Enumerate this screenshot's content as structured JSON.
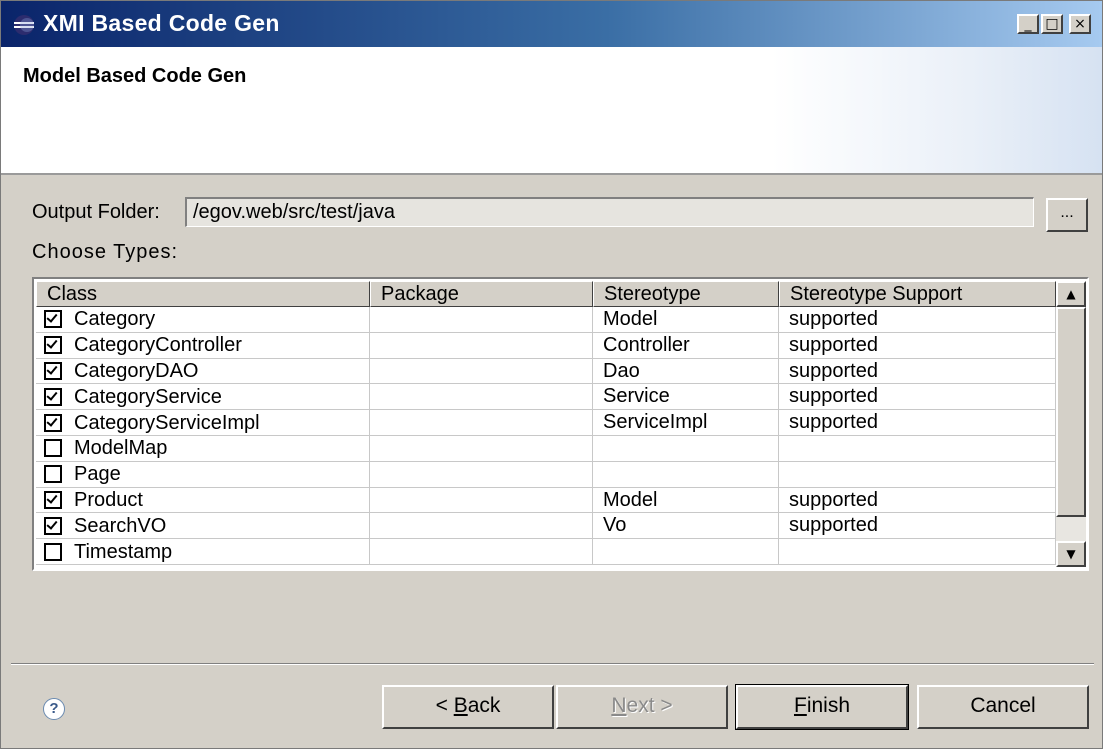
{
  "window": {
    "title": "XMI Based Code Gen",
    "controls": {
      "minimize": "_",
      "maximize": "□",
      "close": "×"
    }
  },
  "header": {
    "title": "Model Based Code Gen"
  },
  "output_folder": {
    "label": "Output Folder:",
    "value": "/egov.web/src/test/java",
    "browse_label": "..."
  },
  "choose_types": {
    "label": "Choose Types:",
    "columns": [
      "Class",
      "Package",
      "Stereotype",
      "Stereotype Support"
    ],
    "rows": [
      {
        "checked": true,
        "class": "Category",
        "package": "",
        "stereotype": "Model",
        "support": "supported"
      },
      {
        "checked": true,
        "class": "CategoryController",
        "package": "",
        "stereotype": "Controller",
        "support": "supported"
      },
      {
        "checked": true,
        "class": "CategoryDAO",
        "package": "",
        "stereotype": "Dao",
        "support": "supported"
      },
      {
        "checked": true,
        "class": "CategoryService",
        "package": "",
        "stereotype": "Service",
        "support": "supported"
      },
      {
        "checked": true,
        "class": "CategoryServiceImpl",
        "package": "",
        "stereotype": "ServiceImpl",
        "support": "supported"
      },
      {
        "checked": false,
        "class": "ModelMap",
        "package": "",
        "stereotype": "",
        "support": ""
      },
      {
        "checked": false,
        "class": "Page",
        "package": "",
        "stereotype": "",
        "support": ""
      },
      {
        "checked": true,
        "class": "Product",
        "package": "",
        "stereotype": "Model",
        "support": "supported"
      },
      {
        "checked": true,
        "class": "SearchVO",
        "package": "",
        "stereotype": "Vo",
        "support": "supported"
      },
      {
        "checked": false,
        "class": "Timestamp",
        "package": "",
        "stereotype": "",
        "support": ""
      }
    ]
  },
  "buttons": {
    "help": "?",
    "back": {
      "prefix": "< ",
      "accel": "B",
      "rest": "ack"
    },
    "next": {
      "accel": "N",
      "rest": "ext >"
    },
    "finish": {
      "accel": "F",
      "rest": "inish"
    },
    "cancel": "Cancel"
  },
  "icons": {
    "title": "eclipse-icon",
    "help": "help-icon",
    "scroll_up": "scroll-up-icon",
    "scroll_down": "scroll-down-icon"
  },
  "colors": {
    "titlebar_start": "#0a246a",
    "titlebar_end": "#a6caf0",
    "dialog_background": "#d4d0c8"
  }
}
